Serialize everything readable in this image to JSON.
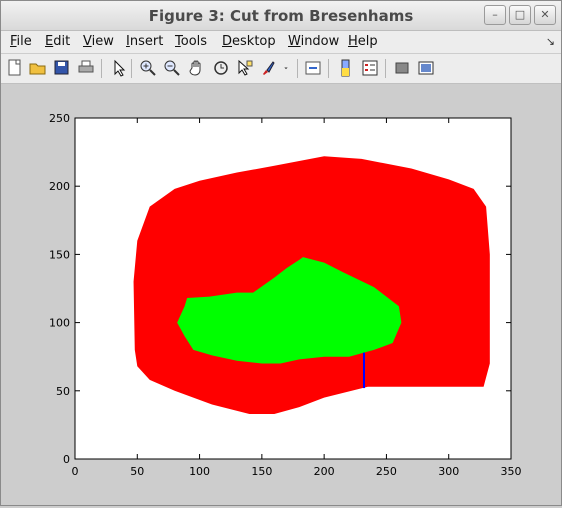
{
  "window": {
    "title": "Figure 3: Cut from Bresenhams"
  },
  "window_controls": {
    "minimize": "–",
    "maximize": "□",
    "close": "✕"
  },
  "menu": [
    {
      "label": "File",
      "mnemonic": "F",
      "rest": "ile"
    },
    {
      "label": "Edit",
      "mnemonic": "E",
      "rest": "dit"
    },
    {
      "label": "View",
      "mnemonic": "V",
      "rest": "iew"
    },
    {
      "label": "Insert",
      "mnemonic": "I",
      "rest": "nsert"
    },
    {
      "label": "Tools",
      "mnemonic": "T",
      "rest": "ools"
    },
    {
      "label": "Desktop",
      "mnemonic": "D",
      "rest": "esktop"
    },
    {
      "label": "Window",
      "mnemonic": "W",
      "rest": "indow"
    },
    {
      "label": "Help",
      "mnemonic": "H",
      "rest": "elp"
    }
  ],
  "menu_overflow": "↘",
  "toolbar": [
    "new-figure-icon",
    "open-file-icon",
    "save-icon",
    "print-icon",
    "edit-plot-arrow-icon",
    "zoom-in-icon",
    "zoom-out-icon",
    "pan-hand-icon",
    "rotate-3d-icon",
    "data-cursor-icon",
    "brush-icon",
    "brush-dropdown-icon",
    "link-plot-icon",
    "colorbar-icon",
    "legend-icon",
    "hide-plot-tools-icon",
    "show-plot-tools-icon"
  ],
  "chart_data": {
    "type": "area",
    "title": "",
    "xlabel": "",
    "ylabel": "",
    "xlim": [
      0,
      350
    ],
    "ylim": [
      0,
      250
    ],
    "xticks": [
      0,
      50,
      100,
      150,
      200,
      250,
      300,
      350
    ],
    "yticks": [
      0,
      50,
      100,
      150,
      200,
      250
    ],
    "grid": false,
    "colors": {
      "outer": "#ff0000",
      "inner": "#00ff00",
      "cut": "#0000ff",
      "background": "#ffffff"
    },
    "regions": [
      {
        "color": "#ff0000",
        "points": [
          [
            48,
            80
          ],
          [
            47,
            130
          ],
          [
            50,
            160
          ],
          [
            60,
            185
          ],
          [
            80,
            198
          ],
          [
            100,
            204
          ],
          [
            130,
            210
          ],
          [
            160,
            215
          ],
          [
            200,
            222
          ],
          [
            230,
            220
          ],
          [
            270,
            213
          ],
          [
            300,
            205
          ],
          [
            320,
            198
          ],
          [
            330,
            185
          ],
          [
            333,
            150
          ],
          [
            333,
            70
          ],
          [
            328,
            53
          ],
          [
            260,
            53
          ],
          [
            235,
            53
          ],
          [
            200,
            45
          ],
          [
            180,
            38
          ],
          [
            160,
            33
          ],
          [
            140,
            33
          ],
          [
            110,
            40
          ],
          [
            80,
            50
          ],
          [
            60,
            58
          ],
          [
            50,
            68
          ]
        ]
      },
      {
        "color": "#00ff00",
        "points": [
          [
            82,
            100
          ],
          [
            88,
            112
          ],
          [
            90,
            118
          ],
          [
            108,
            119
          ],
          [
            130,
            122
          ],
          [
            143,
            122
          ],
          [
            160,
            133
          ],
          [
            170,
            140
          ],
          [
            180,
            146
          ],
          [
            183,
            148
          ],
          [
            200,
            144
          ],
          [
            215,
            137
          ],
          [
            240,
            126
          ],
          [
            260,
            112
          ],
          [
            262,
            100
          ],
          [
            255,
            85
          ],
          [
            240,
            80
          ],
          [
            220,
            75
          ],
          [
            200,
            75
          ],
          [
            180,
            73
          ],
          [
            165,
            70
          ],
          [
            150,
            70
          ],
          [
            130,
            72
          ],
          [
            110,
            76
          ],
          [
            95,
            80
          ],
          [
            88,
            90
          ]
        ]
      }
    ],
    "cut_line": {
      "x": [
        232,
        232
      ],
      "y": [
        52,
        78
      ]
    }
  }
}
